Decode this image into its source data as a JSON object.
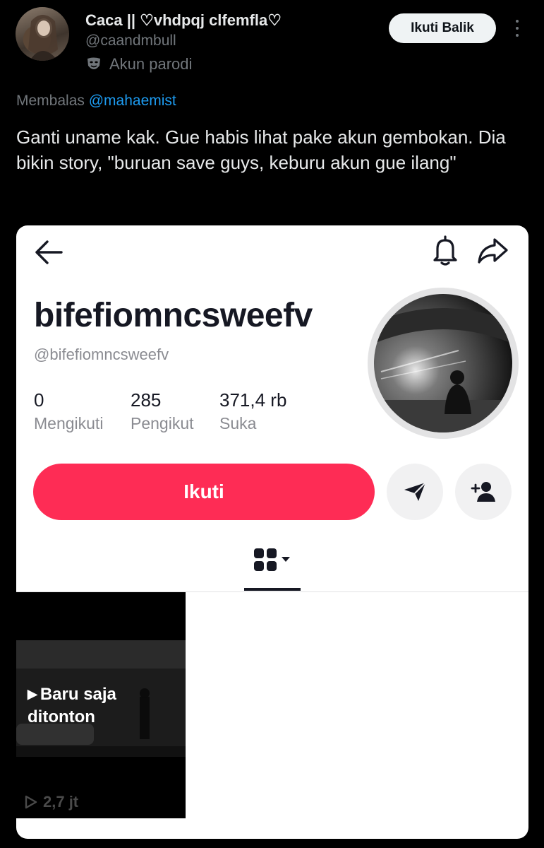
{
  "tweet": {
    "display_name": "Caca || ♡vhdpqj clfemfla♡",
    "handle": "@caandmbull",
    "parody_label": "Akun parodi",
    "follow_back_label": "Ikuti Balik",
    "replying_prefix": "Membalas",
    "replying_to": "@mahaemist",
    "text": "Ganti uname kak. Gue habis lihat pake akun gembokan. Dia bikin story, \"buruan save guys, keburu akun gue ilang\""
  },
  "embedded_profile": {
    "username": "bifefiomncsweefv",
    "handle": "@bifefiomncsweefv",
    "stats": [
      {
        "value": "0",
        "label": "Mengikuti"
      },
      {
        "value": "285",
        "label": "Pengikut"
      },
      {
        "value": "371,4 rb",
        "label": "Suka"
      }
    ],
    "follow_label": "Ikuti",
    "accent_color": "#fe2c55",
    "video": {
      "watched_line1": "Baru saja",
      "watched_line2": "ditonton",
      "views": "2,7 jt"
    }
  }
}
